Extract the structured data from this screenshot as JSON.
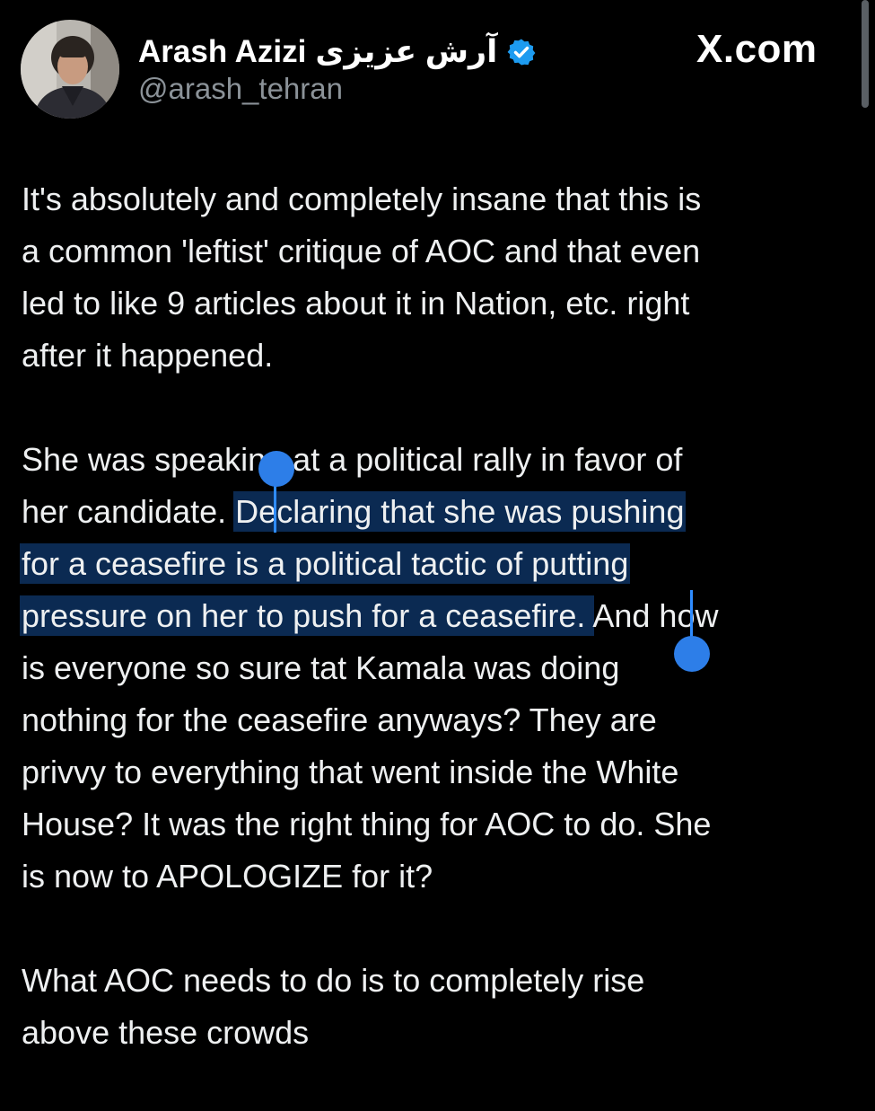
{
  "author": {
    "display_name": "Arash Azizi",
    "display_name_native": "آرش عزیزی",
    "handle": "@arash_tehran",
    "verified_icon": "verified-badge-icon",
    "verified_color": "#1d9bf0"
  },
  "brand": "X.com",
  "tweet": {
    "paragraphs": [
      {
        "lines": [
          {
            "text": "It's absolutely and completely insane that this is"
          },
          {
            "text": "a common 'leftist' critique of AOC and that even"
          },
          {
            "text": "led to like 9 articles about it in Nation, etc. right"
          },
          {
            "text": "after it happened."
          }
        ]
      },
      {
        "lines": [
          {
            "text": "She was speaking at a political rally in favor of"
          },
          {
            "pre": "her candidate. ",
            "hl": "Declaring that she was pushing",
            "post": ""
          },
          {
            "pre": "",
            "hl": "for a ceasefire is a political tactic of putting",
            "post": ""
          },
          {
            "pre": "",
            "hl": "pressure on her to push for a ceasefire. ",
            "post": "And how"
          },
          {
            "text": "is everyone so sure tat Kamala was doing"
          },
          {
            "text": "nothing for the ceasefire anyways? They are"
          },
          {
            "text": "privvy to everything that went inside the White"
          },
          {
            "text": "House? It was the right thing for AOC to do. She"
          },
          {
            "text": "is now to APOLOGIZE for it?"
          }
        ]
      },
      {
        "lines": [
          {
            "text": "What AOC needs to do is to completely rise"
          },
          {
            "text": "above these crowds"
          }
        ]
      }
    ],
    "selection_color": "#0b2a52",
    "selection_handle_color": "#2d7ee8"
  }
}
